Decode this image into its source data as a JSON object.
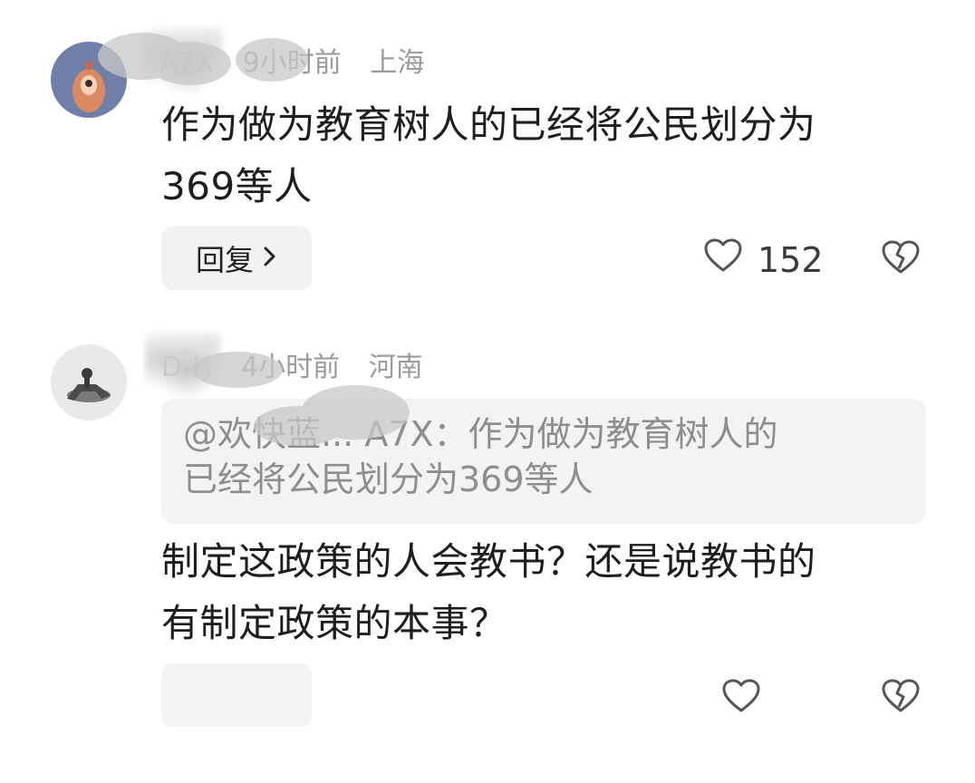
{
  "comments": [
    {
      "username": "欢快蓝... A7X",
      "username_visible": "A7X",
      "time": "9小时前",
      "location": "上海",
      "text_line1": "作为做为教育树人的已经将公民划分为",
      "text_line2": "369等人",
      "reply_label": "回复",
      "likes": "152"
    },
    {
      "username": "D-H",
      "time": "4小时前",
      "location": "河南",
      "quote_line1": "@欢快蓝... A7X：作为做为教育树人的",
      "quote_line2": "已经将公民划分为369等人",
      "text_line1": "制定这政策的人会教书？还是说教书的",
      "text_line2": "有制定政策的本事？"
    }
  ],
  "icons": {
    "like": "heart-outline-icon",
    "dislike": "broken-heart-icon",
    "chevron": "chevron-right-icon"
  },
  "colors": {
    "meta": "#9a9a9a",
    "quote_bg": "#f3f3f3",
    "button_bg": "#f2f2f2"
  }
}
